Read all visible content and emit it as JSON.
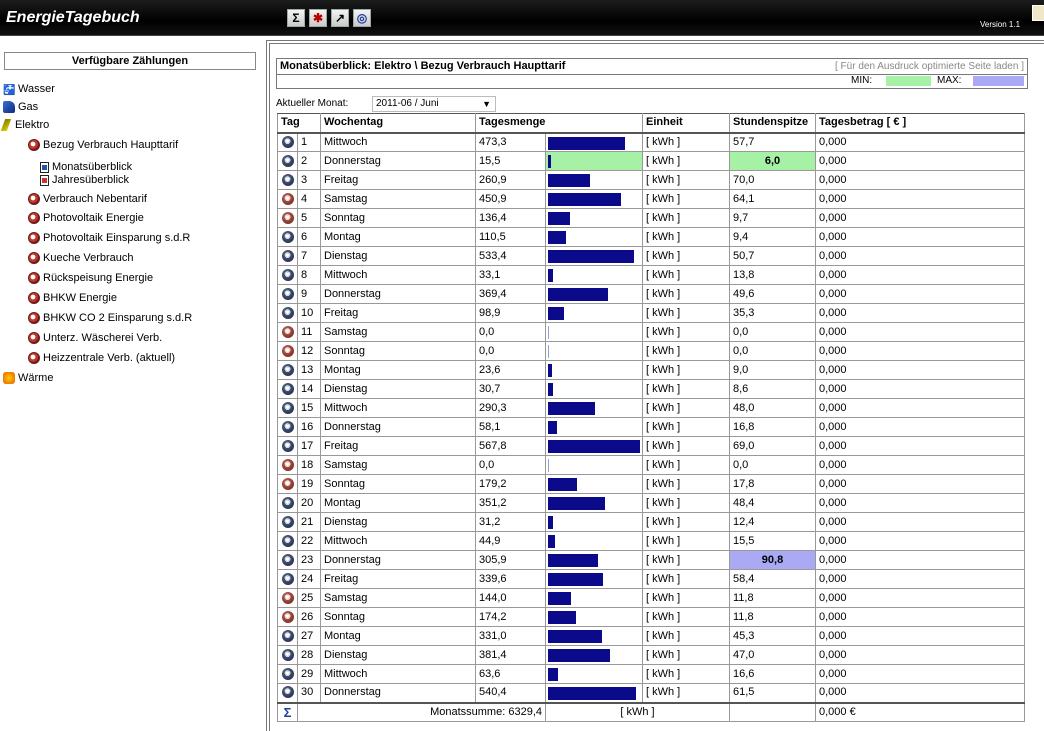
{
  "app": {
    "title": "EnergieTagebuch",
    "version": "Version 1.1",
    "toolbar": [
      {
        "icon": "sigma-icon",
        "glyph": "Σ"
      },
      {
        "icon": "meter-icon",
        "glyph": "✱"
      },
      {
        "icon": "export-arrow-icon",
        "glyph": "↗"
      },
      {
        "icon": "gauge-icon",
        "glyph": "◎"
      }
    ]
  },
  "sidebar": {
    "header": "Verfügbare Zählungen",
    "tree": [
      {
        "label": "Wasser",
        "icon": "water-tap-icon",
        "level": 0
      },
      {
        "label": "Gas",
        "icon": "gas-icon",
        "level": 0
      },
      {
        "label": "Elektro",
        "icon": "pencil-icon",
        "level": 0
      },
      {
        "label": "Bezug Verbrauch Haupttarif",
        "icon": "meter-icon",
        "level": 1
      },
      {
        "label": "Monatsüberblick",
        "icon": "document-icon",
        "level": 2
      },
      {
        "label": "Jahresüberblick",
        "icon": "document-icon",
        "level": 2
      },
      {
        "label": "Verbrauch Nebentarif",
        "icon": "meter-icon",
        "level": 1
      },
      {
        "label": "Photovoltaik Energie",
        "icon": "meter-icon",
        "level": 1
      },
      {
        "label": "Photovoltaik Einsparung s.d.R",
        "icon": "meter-icon",
        "level": 1
      },
      {
        "label": "Kueche Verbrauch",
        "icon": "meter-icon",
        "level": 1
      },
      {
        "label": "Rückspeisung Energie",
        "icon": "meter-icon",
        "level": 1
      },
      {
        "label": "BHKW Energie",
        "icon": "meter-icon",
        "level": 1
      },
      {
        "label": "BHKW CO 2 Einsparung s.d.R",
        "icon": "meter-icon",
        "level": 1
      },
      {
        "label": "Unterz. Wäscherei Verb.",
        "icon": "meter-icon",
        "level": 1
      },
      {
        "label": "Heizzentrale Verb. (aktuell)",
        "icon": "meter-icon",
        "level": 1
      },
      {
        "label": "Wärme",
        "icon": "heat-icon",
        "level": 0
      }
    ]
  },
  "panel": {
    "title": "Monatsüberblick: Elektro \\ Bezug Verbrauch Haupttarif",
    "print_link": "[ Für den Ausdruck optimierte Seite laden ]",
    "min_label": "MIN:",
    "max_label": "MAX:",
    "min_color": "#a6f1a6",
    "max_color": "#a9a9f4",
    "month_label": "Aktueller Monat:",
    "month_value": "2011-06 / Juni"
  },
  "table": {
    "columns": [
      "Tag",
      "Wochentag",
      "Tagesmenge",
      "Einheit",
      "Stundenspitze",
      "Tagesbetrag [ € ]"
    ],
    "bar_max": 567.8,
    "rows": [
      {
        "tag": "1",
        "weekday": "Mittwoch",
        "menge": "473,3",
        "value": 473.3,
        "unit": "[ kWh ]",
        "spitze": "57,7",
        "betrag": "0,000",
        "weekend": false
      },
      {
        "tag": "2",
        "weekday": "Donnerstag",
        "menge": "15,5",
        "value": 15.5,
        "unit": "[ kWh ]",
        "spitze": "6,0",
        "betrag": "0,000",
        "weekend": false,
        "min": true
      },
      {
        "tag": "3",
        "weekday": "Freitag",
        "menge": "260,9",
        "value": 260.9,
        "unit": "[ kWh ]",
        "spitze": "70,0",
        "betrag": "0,000",
        "weekend": false
      },
      {
        "tag": "4",
        "weekday": "Samstag",
        "menge": "450,9",
        "value": 450.9,
        "unit": "[ kWh ]",
        "spitze": "64,1",
        "betrag": "0,000",
        "weekend": true
      },
      {
        "tag": "5",
        "weekday": "Sonntag",
        "menge": "136,4",
        "value": 136.4,
        "unit": "[ kWh ]",
        "spitze": "9,7",
        "betrag": "0,000",
        "weekend": true
      },
      {
        "tag": "6",
        "weekday": "Montag",
        "menge": "110,5",
        "value": 110.5,
        "unit": "[ kWh ]",
        "spitze": "9,4",
        "betrag": "0,000",
        "weekend": false
      },
      {
        "tag": "7",
        "weekday": "Dienstag",
        "menge": "533,4",
        "value": 533.4,
        "unit": "[ kWh ]",
        "spitze": "50,7",
        "betrag": "0,000",
        "weekend": false
      },
      {
        "tag": "8",
        "weekday": "Mittwoch",
        "menge": "33,1",
        "value": 33.1,
        "unit": "[ kWh ]",
        "spitze": "13,8",
        "betrag": "0,000",
        "weekend": false
      },
      {
        "tag": "9",
        "weekday": "Donnerstag",
        "menge": "369,4",
        "value": 369.4,
        "unit": "[ kWh ]",
        "spitze": "49,6",
        "betrag": "0,000",
        "weekend": false
      },
      {
        "tag": "10",
        "weekday": "Freitag",
        "menge": "98,9",
        "value": 98.9,
        "unit": "[ kWh ]",
        "spitze": "35,3",
        "betrag": "0,000",
        "weekend": false
      },
      {
        "tag": "11",
        "weekday": "Samstag",
        "menge": "0,0",
        "value": 0.0,
        "unit": "[ kWh ]",
        "spitze": "0,0",
        "betrag": "0,000",
        "weekend": true
      },
      {
        "tag": "12",
        "weekday": "Sonntag",
        "menge": "0,0",
        "value": 0.0,
        "unit": "[ kWh ]",
        "spitze": "0,0",
        "betrag": "0,000",
        "weekend": true
      },
      {
        "tag": "13",
        "weekday": "Montag",
        "menge": "23,6",
        "value": 23.6,
        "unit": "[ kWh ]",
        "spitze": "9,0",
        "betrag": "0,000",
        "weekend": false
      },
      {
        "tag": "14",
        "weekday": "Dienstag",
        "menge": "30,7",
        "value": 30.7,
        "unit": "[ kWh ]",
        "spitze": "8,6",
        "betrag": "0,000",
        "weekend": false
      },
      {
        "tag": "15",
        "weekday": "Mittwoch",
        "menge": "290,3",
        "value": 290.3,
        "unit": "[ kWh ]",
        "spitze": "48,0",
        "betrag": "0,000",
        "weekend": false
      },
      {
        "tag": "16",
        "weekday": "Donnerstag",
        "menge": "58,1",
        "value": 58.1,
        "unit": "[ kWh ]",
        "spitze": "16,8",
        "betrag": "0,000",
        "weekend": false
      },
      {
        "tag": "17",
        "weekday": "Freitag",
        "menge": "567,8",
        "value": 567.8,
        "unit": "[ kWh ]",
        "spitze": "69,0",
        "betrag": "0,000",
        "weekend": false
      },
      {
        "tag": "18",
        "weekday": "Samstag",
        "menge": "0,0",
        "value": 0.0,
        "unit": "[ kWh ]",
        "spitze": "0,0",
        "betrag": "0,000",
        "weekend": true
      },
      {
        "tag": "19",
        "weekday": "Sonntag",
        "menge": "179,2",
        "value": 179.2,
        "unit": "[ kWh ]",
        "spitze": "17,8",
        "betrag": "0,000",
        "weekend": true
      },
      {
        "tag": "20",
        "weekday": "Montag",
        "menge": "351,2",
        "value": 351.2,
        "unit": "[ kWh ]",
        "spitze": "48,4",
        "betrag": "0,000",
        "weekend": false
      },
      {
        "tag": "21",
        "weekday": "Dienstag",
        "menge": "31,2",
        "value": 31.2,
        "unit": "[ kWh ]",
        "spitze": "12,4",
        "betrag": "0,000",
        "weekend": false
      },
      {
        "tag": "22",
        "weekday": "Mittwoch",
        "menge": "44,9",
        "value": 44.9,
        "unit": "[ kWh ]",
        "spitze": "15,5",
        "betrag": "0,000",
        "weekend": false
      },
      {
        "tag": "23",
        "weekday": "Donnerstag",
        "menge": "305,9",
        "value": 305.9,
        "unit": "[ kWh ]",
        "spitze": "90,8",
        "betrag": "0,000",
        "weekend": false,
        "max": true
      },
      {
        "tag": "24",
        "weekday": "Freitag",
        "menge": "339,6",
        "value": 339.6,
        "unit": "[ kWh ]",
        "spitze": "58,4",
        "betrag": "0,000",
        "weekend": false
      },
      {
        "tag": "25",
        "weekday": "Samstag",
        "menge": "144,0",
        "value": 144.0,
        "unit": "[ kWh ]",
        "spitze": "11,8",
        "betrag": "0,000",
        "weekend": true
      },
      {
        "tag": "26",
        "weekday": "Sonntag",
        "menge": "174,2",
        "value": 174.2,
        "unit": "[ kWh ]",
        "spitze": "11,8",
        "betrag": "0,000",
        "weekend": true
      },
      {
        "tag": "27",
        "weekday": "Montag",
        "menge": "331,0",
        "value": 331.0,
        "unit": "[ kWh ]",
        "spitze": "45,3",
        "betrag": "0,000",
        "weekend": false
      },
      {
        "tag": "28",
        "weekday": "Dienstag",
        "menge": "381,4",
        "value": 381.4,
        "unit": "[ kWh ]",
        "spitze": "47,0",
        "betrag": "0,000",
        "weekend": false
      },
      {
        "tag": "29",
        "weekday": "Mittwoch",
        "menge": "63,6",
        "value": 63.6,
        "unit": "[ kWh ]",
        "spitze": "16,6",
        "betrag": "0,000",
        "weekend": false
      },
      {
        "tag": "30",
        "weekday": "Donnerstag",
        "menge": "540,4",
        "value": 540.4,
        "unit": "[ kWh ]",
        "spitze": "61,5",
        "betrag": "0,000",
        "weekend": false
      }
    ],
    "footer": {
      "sigma": "Σ",
      "sum_label": "Monatssumme:",
      "sum_value": "6329,4",
      "unit": "[ kWh ]",
      "betrag": "0,000 €"
    }
  }
}
